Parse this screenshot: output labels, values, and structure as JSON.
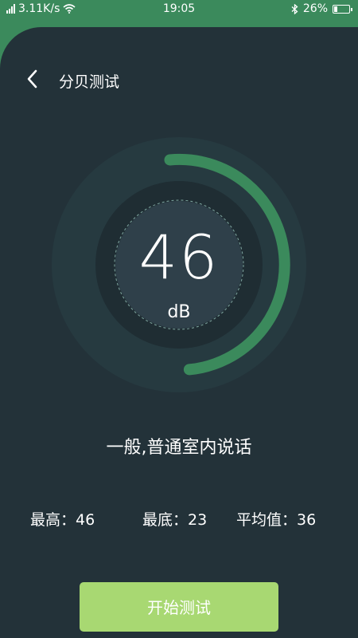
{
  "status_bar": {
    "network_speed": "3.11K/s",
    "time": "19:05",
    "battery": "26%",
    "battery_level": 0.26,
    "icons": [
      "signal-icon",
      "wifi-icon",
      "bluetooth-icon",
      "battery-icon"
    ]
  },
  "header": {
    "title": "分贝测试",
    "back_icon": "chevron-left-icon"
  },
  "meter": {
    "value": "46",
    "unit": "dB",
    "progress_fraction": 0.46
  },
  "level_description": "一般,普通室内说话",
  "stats": {
    "max_label": "最高",
    "max_value": "46",
    "min_label": "最底",
    "min_value": "23",
    "avg_label": "平均值",
    "avg_value": "36"
  },
  "start_button_label": "开始测试",
  "colors": {
    "background": "#233239",
    "accent": "#3b8a5c",
    "button": "#a8d872"
  }
}
